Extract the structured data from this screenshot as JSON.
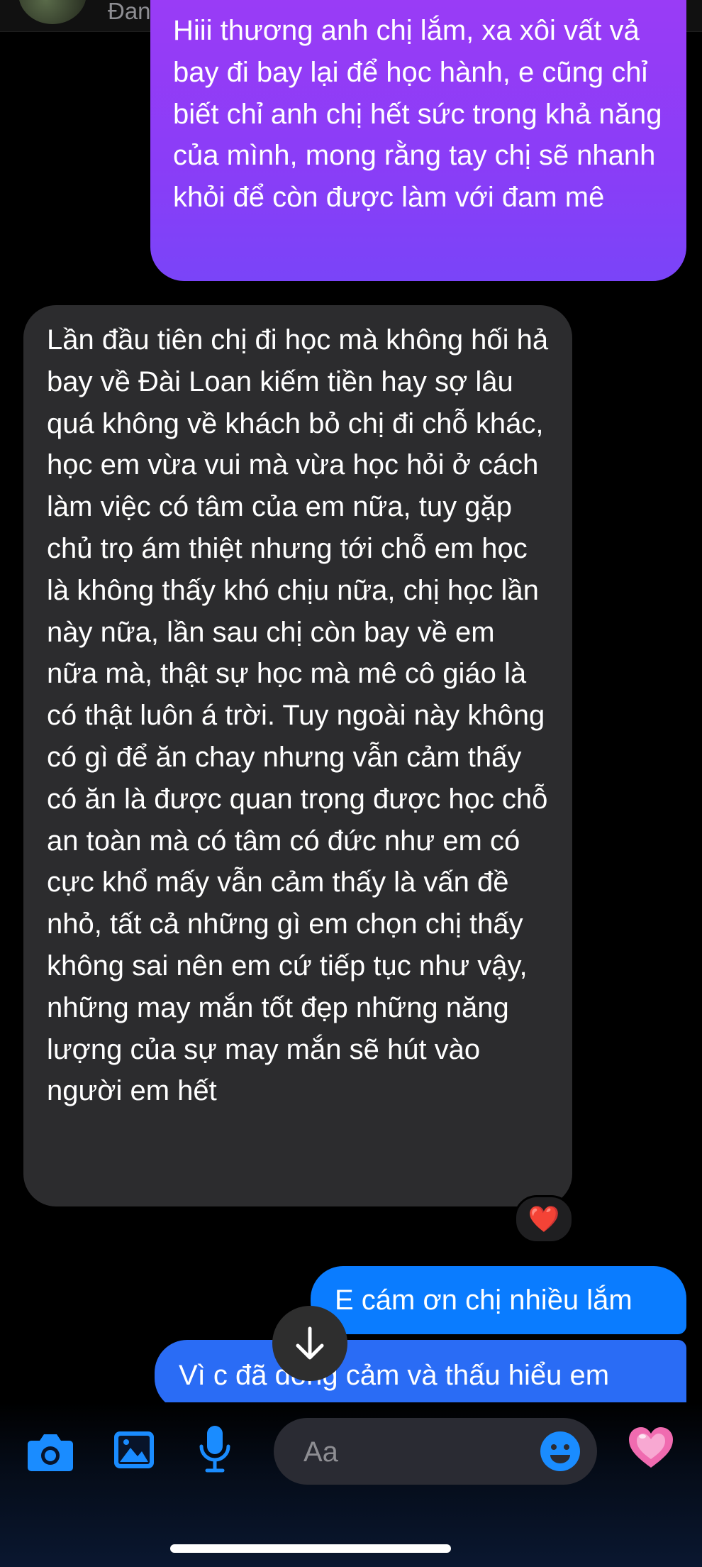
{
  "header": {
    "status": "Đang hoạt động"
  },
  "messages": {
    "sent_purple": "Hiii thương anh chị lắm, xa xôi vất vả bay đi bay lại để học hành, e cũng chỉ biết chỉ anh chị hết sức trong khả năng của mình, mong rằng tay chị sẽ nhanh khỏi để còn được làm với đam mê",
    "received": "Lần đầu tiên chị đi học mà không hối hả bay về Đài Loan kiếm tiền hay sợ lâu quá không về khách bỏ chị đi chỗ khác, học em vừa vui mà vừa học hỏi ở cách làm việc có tâm của em nữa, tuy gặp chủ trọ ám thiệt nhưng tới chỗ em học là không thấy khó chịu nữa, chị học lần này nữa, lần sau chị còn bay về em nữa mà, thật sự học mà mê cô giáo là có thật luôn á trời. Tuy ngoài này không có gì để ăn chay nhưng vẫn cảm thấy có ăn là được quan trọng được học chỗ an toàn mà có tâm có đức như em có cực khổ mấy vẫn cảm thấy là vấn đề nhỏ, tất cả những gì em chọn chị thấy không sai nên em cứ tiếp tục như vậy, những may mắn tốt đẹp những năng lượng của sự may mắn sẽ hút vào người em hết",
    "reaction": "❤️",
    "sent_blue_1": "E cám ơn chị nhiều lắm",
    "sent_blue_2": "Vì c đã đồng cảm và thấu hiểu em"
  },
  "composer": {
    "placeholder": "Aa",
    "icons": [
      "camera-icon",
      "gallery-icon",
      "microphone-icon",
      "emoji-icon",
      "heart-icon"
    ]
  },
  "colors": {
    "purple": "#8a3df7",
    "blue": "#0a7cff",
    "received": "#2c2c2e",
    "icon_blue": "#1a8cff",
    "heart_pink": "#f06bb0"
  }
}
